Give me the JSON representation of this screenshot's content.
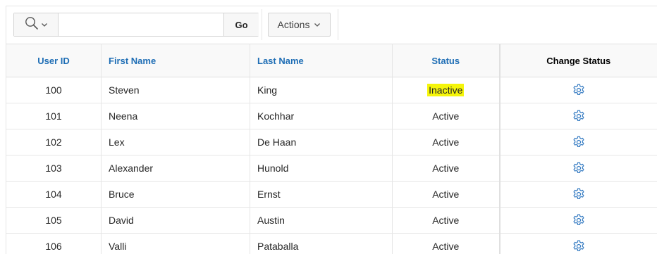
{
  "toolbar": {
    "search_column_icon": "search-icon",
    "search_input_value": "",
    "search_placeholder": "",
    "go_label": "Go",
    "actions_label": "Actions"
  },
  "table": {
    "headers": {
      "user_id": "User ID",
      "first_name": "First Name",
      "last_name": "Last Name",
      "status": "Status",
      "change_status": "Change Status"
    },
    "rows": [
      {
        "user_id": "100",
        "first_name": "Steven",
        "last_name": "King",
        "status": "Inactive",
        "highlighted": true,
        "action_icon": "gear-icon"
      },
      {
        "user_id": "101",
        "first_name": "Neena",
        "last_name": "Kochhar",
        "status": "Active",
        "highlighted": false,
        "action_icon": "gear-icon"
      },
      {
        "user_id": "102",
        "first_name": "Lex",
        "last_name": "De Haan",
        "status": "Active",
        "highlighted": false,
        "action_icon": "gear-icon"
      },
      {
        "user_id": "103",
        "first_name": "Alexander",
        "last_name": "Hunold",
        "status": "Active",
        "highlighted": false,
        "action_icon": "gear-icon"
      },
      {
        "user_id": "104",
        "first_name": "Bruce",
        "last_name": "Ernst",
        "status": "Active",
        "highlighted": false,
        "action_icon": "gear-icon"
      },
      {
        "user_id": "105",
        "first_name": "David",
        "last_name": "Austin",
        "status": "Active",
        "highlighted": false,
        "action_icon": "gear-icon"
      },
      {
        "user_id": "106",
        "first_name": "Valli",
        "last_name": "Pataballa",
        "status": "Active",
        "highlighted": false,
        "action_icon": "gear-icon"
      }
    ]
  },
  "colors": {
    "header_link": "#1f6eb5",
    "highlight": "#f5f50a",
    "gear": "#3b7fc4"
  }
}
